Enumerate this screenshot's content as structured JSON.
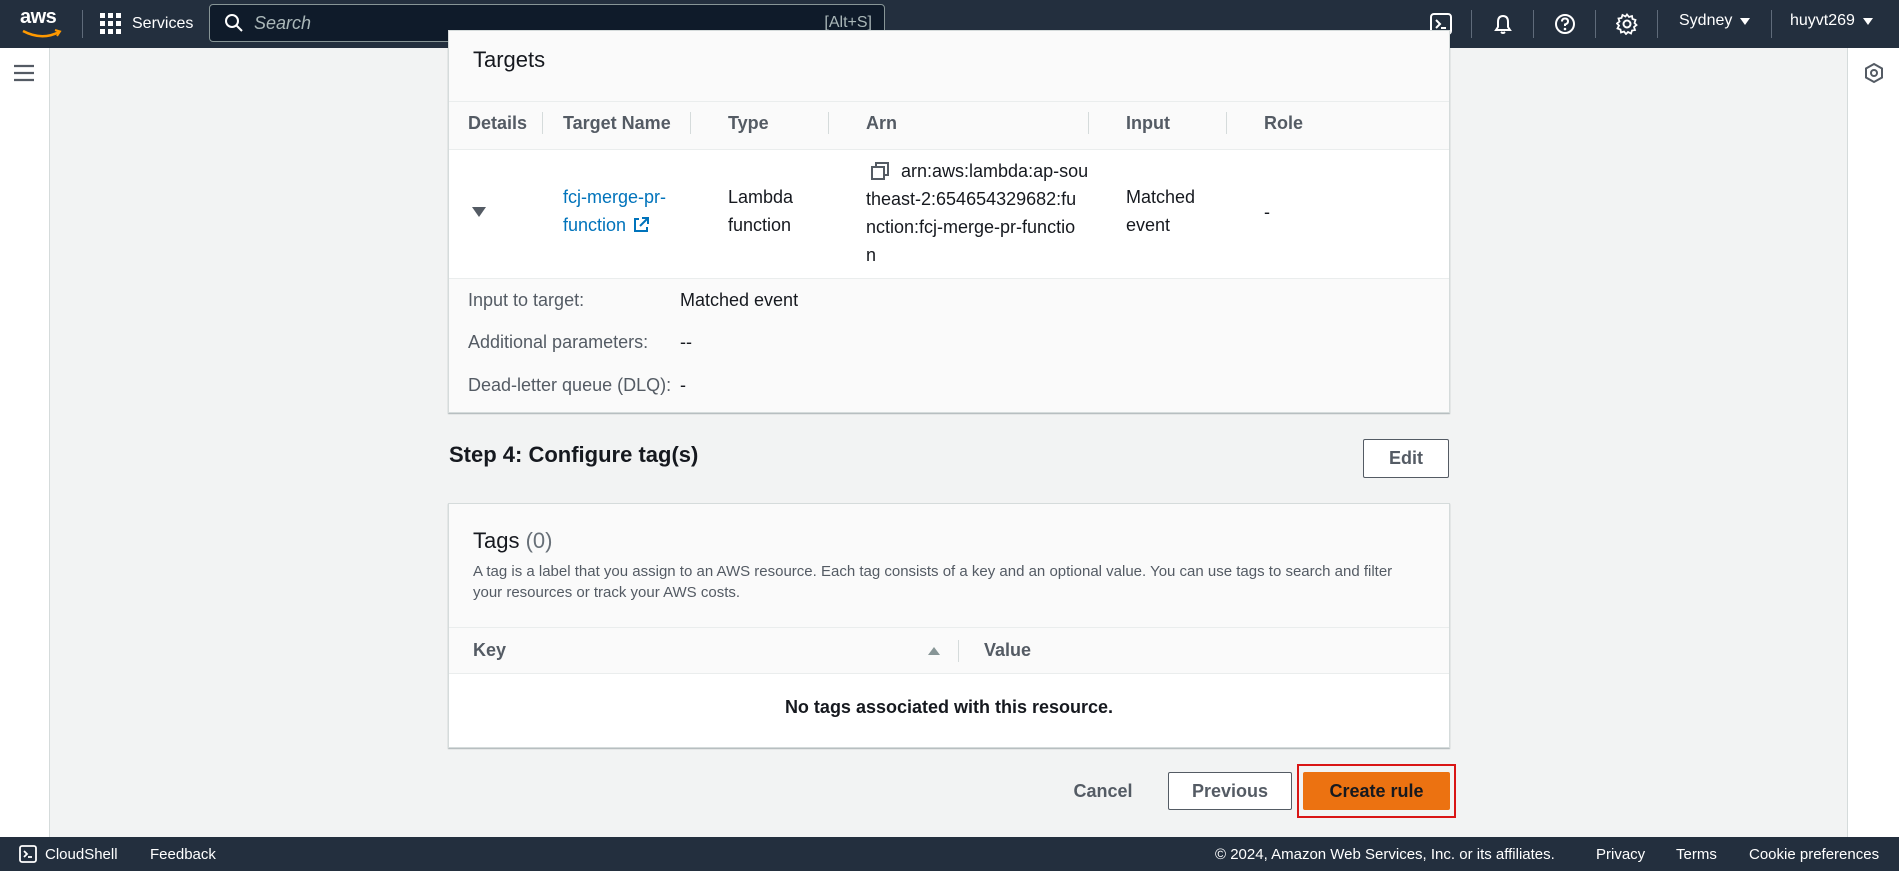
{
  "topnav": {
    "logo_text": "aws",
    "services_label": "Services",
    "search_placeholder": "Search",
    "search_shortcut": "[Alt+S]",
    "region": "Sydney",
    "user": "huyvt269"
  },
  "targets_panel": {
    "title": "Targets",
    "columns": [
      "Details",
      "Target Name",
      "Type",
      "Arn",
      "Input",
      "Role"
    ],
    "row": {
      "target_name_line1": "fcj-merge-pr-",
      "target_name_line2": "function",
      "type_line1": "Lambda",
      "type_line2": "function",
      "arn_lines": [
        "arn:aws:lambda:ap-sou",
        "theast-2:654654329682:fu",
        "nction:fcj-merge-pr-functio",
        "n"
      ],
      "input_line1": "Matched",
      "input_line2": "event",
      "role": "-"
    },
    "details": {
      "input_label": "Input to target:",
      "input_value": "Matched event",
      "params_label": "Additional parameters:",
      "params_value": "--",
      "dlq_label": "Dead-letter queue (DLQ):",
      "dlq_value": "-"
    }
  },
  "step4": {
    "title": "Step 4: Configure tag(s)",
    "edit_label": "Edit"
  },
  "tags_panel": {
    "title": "Tags",
    "count": "(0)",
    "description_line1": "A tag is a label that you assign to an AWS resource. Each tag consists of a key and an optional value. You can use tags to search and filter",
    "description_line2": "your resources or track your AWS costs.",
    "col_key": "Key",
    "col_value": "Value",
    "empty_text": "No tags associated with this resource."
  },
  "actions": {
    "cancel": "Cancel",
    "previous": "Previous",
    "create": "Create rule"
  },
  "footer": {
    "cloudshell": "CloudShell",
    "feedback": "Feedback",
    "copyright": "© 2024, Amazon Web Services, Inc. or its affiliates.",
    "privacy": "Privacy",
    "terms": "Terms",
    "cookie": "Cookie preferences"
  },
  "colors": {
    "nav_bg": "#232f3e",
    "link": "#0073bb",
    "primary": "#ec7211",
    "highlight": "#d91515"
  }
}
